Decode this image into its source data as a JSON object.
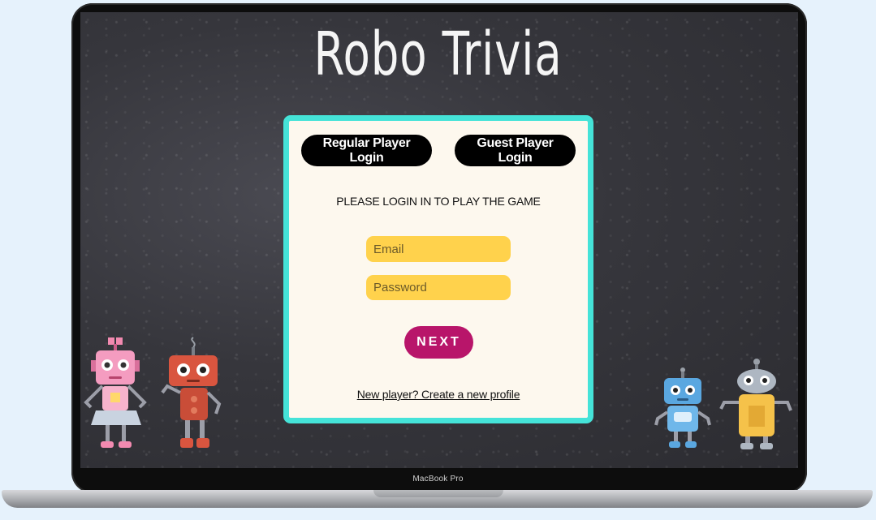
{
  "device": {
    "label": "MacBook Pro"
  },
  "app": {
    "title": "Robo Trivia"
  },
  "login": {
    "regular_label": "Regular Player Login",
    "guest_label": "Guest Player Login",
    "prompt": "PLEASE LOGIN IN TO PLAY THE GAME",
    "email_placeholder": "Email",
    "password_placeholder": "Password",
    "next_label": "NEXT",
    "signup_link": "New player? Create a new profile"
  },
  "colors": {
    "accent_border": "#45e3d8",
    "field_fill": "#ffd24c",
    "next_button": "#b8156a",
    "card_background": "#fdf8ee",
    "board": "#36363c"
  },
  "decorations": [
    "pink-robot-icon",
    "red-robot-icon",
    "blue-robot-icon",
    "yellow-robot-icon"
  ]
}
